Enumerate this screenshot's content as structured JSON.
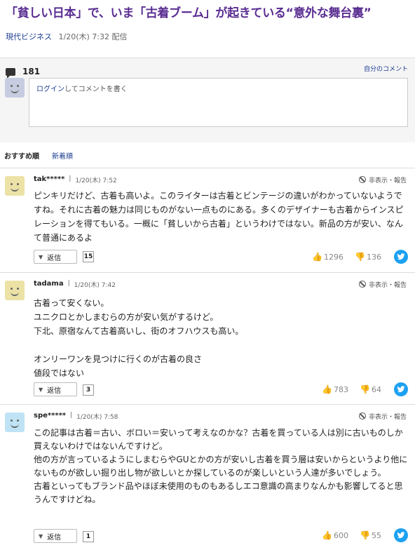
{
  "article": {
    "title": "「貧しい日本」で、いま「古着ブーム」が起きている“意外な舞台裏”",
    "source": "現代ビジネス",
    "date": "1/20(木) 7:32 配信"
  },
  "comment_panel": {
    "count": "181",
    "my_comments_label": "自分のコメント",
    "input": {
      "login_link": "ログイン",
      "placeholder_rest": "してコメントを書く"
    }
  },
  "sort": {
    "recommended": "おすすめ順",
    "newest": "新着順"
  },
  "comments": [
    {
      "user": "tak*****",
      "date": "1/20(木) 7:52",
      "hide_label": "非表示・報告",
      "avatar_color": "#ece2a6",
      "body": "ピンキリだけど、古着も高いよ。このライターは古着とビンテージの違いがわかっていないようですね。それに古着の魅力は同じものがない一点ものにある。多くのデザイナーも古着からインスピレーションを得てもいる。一概に「貧しいから古着」というわけではない。新品の方が安い、なんて普通にあるよ",
      "reply_label": "返信",
      "reply_count": "15",
      "likes": "1296",
      "dislikes": "136"
    },
    {
      "user": "tadama",
      "date": "1/20(木) 7:42",
      "hide_label": "非表示・報告",
      "avatar_color": "#ece2a6",
      "body": "古着って安くない。\nユニクロとかしまむらの方が安い気がするけど。\n下北、原宿なんて古着高いし、街のオフハウスも高い。\n\nオンリーワンを見つけに行くのが古着の良さ\n値段ではない",
      "reply_label": "返信",
      "reply_count": "3",
      "likes": "783",
      "dislikes": "64"
    },
    {
      "user": "spe*****",
      "date": "1/20(木) 7:58",
      "hide_label": "非表示・報告",
      "avatar_color": "#bfe3f5",
      "body": "この記事は古着＝古い、ボロい＝安いって考えなのかな？古着を買っている人は別に古いものしか買えないわけではないんですけど。\n他の方が言っているようにしまむらやGUとかの方が安いし古着を買う層は安いからというより他にないものが欲しい掘り出し物が欲しいとか探しているのが楽しいという人達が多いでしょう。\n古着といってもブランド品やほぼ未使用のものもあるしエコ意識の高まりなんかも影響してると思うんですけどね。",
      "reply_label": "返信",
      "reply_count": "1",
      "likes": "600",
      "dislikes": "55"
    }
  ]
}
